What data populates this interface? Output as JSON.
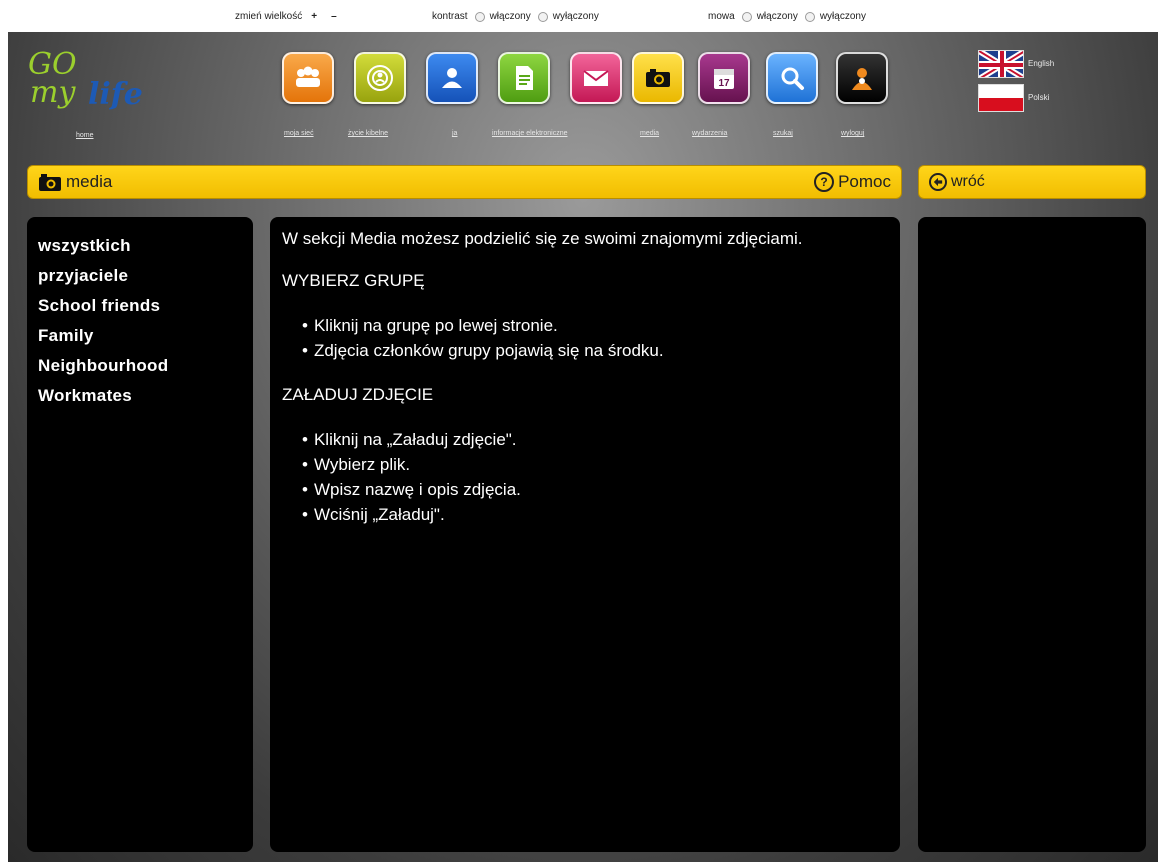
{
  "topbar": {
    "resize_label": "zmień wielkość",
    "resize_plus": "+",
    "resize_minus": "–",
    "contrast_label": "kontrast",
    "contrast_on": "włączony",
    "contrast_off": "wyłączony",
    "speech_label": "mowa",
    "speech_on": "włączony",
    "speech_off": "wyłączony"
  },
  "logo": {
    "line1": "GO",
    "line2": "my",
    "line3": "life",
    "home_label": "home"
  },
  "nav": [
    {
      "icon": "people-icon",
      "label": "moja sieć",
      "color": "#f08a1e"
    },
    {
      "icon": "life-event-icon",
      "label": "życie kibelne",
      "color": "#b8c21a"
    },
    {
      "icon": "profile-icon",
      "label": "ja",
      "color": "#1e6ed8"
    },
    {
      "icon": "document-icon",
      "label": "informacje elektroniczne",
      "color": "#6cbf22"
    },
    {
      "icon": "mail-icon",
      "label": "",
      "color": "#e23a7a"
    },
    {
      "icon": "camera-icon",
      "label": "media",
      "color": "#f5c800"
    },
    {
      "icon": "calendar-icon",
      "label": "wydarzenia",
      "color": "#8a2570"
    },
    {
      "icon": "search-icon",
      "label": "szukaj",
      "color": "#3a8fe6"
    },
    {
      "icon": "help-person-icon",
      "label": "wyloguj",
      "color": "#1a1a1a"
    }
  ],
  "language": {
    "english": "English",
    "polish": "Polski"
  },
  "header": {
    "title": "media",
    "help_label": "Pomoc",
    "back_label": "wróć"
  },
  "groups": [
    "wszystkich",
    "przyjaciele",
    "School friends",
    "Family",
    "Neighbourhood",
    "Workmates"
  ],
  "content": {
    "intro": "W sekcji Media możesz podzielić się ze swoimi znajomymi zdjęciami.",
    "section1_title": "WYBIERZ GRUPĘ",
    "section1_steps": [
      "Kliknij na grupę po lewej stronie.",
      "Zdjęcia członków grupy pojawią się na środku."
    ],
    "section2_title": "ZAŁADUJ ZDJĘCIE",
    "section2_steps": [
      "Kliknij na „Załaduj zdjęcie\".",
      "Wybierz plik.",
      "Wpisz nazwę i opis zdjęcia.",
      "Wciśnij „Załaduj\"."
    ]
  }
}
